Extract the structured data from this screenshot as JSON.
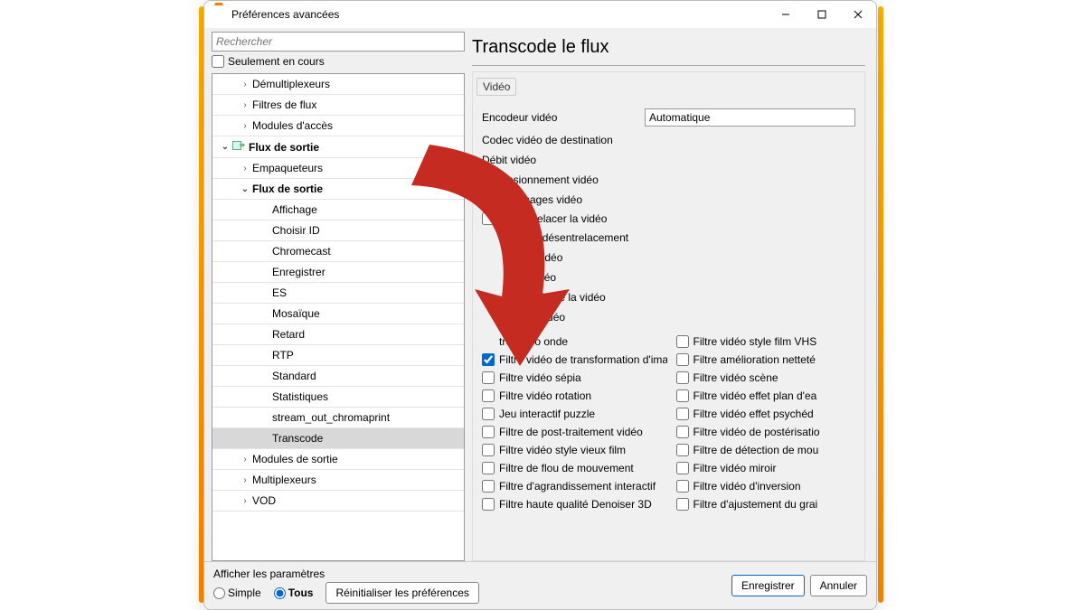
{
  "window": {
    "title": "Préférences avancées"
  },
  "search": {
    "placeholder": "Rechercher",
    "only_current_label": "Seulement en cours"
  },
  "tree": [
    {
      "label": "Démultiplexeurs",
      "indent": 1,
      "expander": "›",
      "bold": false
    },
    {
      "label": "Filtres de flux",
      "indent": 1,
      "expander": "›",
      "bold": false
    },
    {
      "label": "Modules d'accès",
      "indent": 1,
      "expander": "›",
      "bold": false
    },
    {
      "label": "Flux de sortie",
      "indent": 0,
      "expander": "⌄",
      "bold": true,
      "icon": "output"
    },
    {
      "label": "Empaqueteurs",
      "indent": 1,
      "expander": "›",
      "bold": false
    },
    {
      "label": "Flux de sortie",
      "indent": 1,
      "expander": "⌄",
      "bold": true
    },
    {
      "label": "Affichage",
      "indent": 2,
      "expander": "",
      "bold": false
    },
    {
      "label": "Choisir ID",
      "indent": 2,
      "expander": "",
      "bold": false
    },
    {
      "label": "Chromecast",
      "indent": 2,
      "expander": "",
      "bold": false
    },
    {
      "label": "Enregistrer",
      "indent": 2,
      "expander": "",
      "bold": false
    },
    {
      "label": "ES",
      "indent": 2,
      "expander": "",
      "bold": false
    },
    {
      "label": "Mosaïque",
      "indent": 2,
      "expander": "",
      "bold": false
    },
    {
      "label": "Retard",
      "indent": 2,
      "expander": "",
      "bold": false
    },
    {
      "label": "RTP",
      "indent": 2,
      "expander": "",
      "bold": false
    },
    {
      "label": "Standard",
      "indent": 2,
      "expander": "",
      "bold": false
    },
    {
      "label": "Statistiques",
      "indent": 2,
      "expander": "",
      "bold": false
    },
    {
      "label": "stream_out_chromaprint",
      "indent": 2,
      "expander": "",
      "bold": false
    },
    {
      "label": "Transcode",
      "indent": 2,
      "expander": "",
      "bold": false,
      "selected": true
    },
    {
      "label": "Modules de sortie",
      "indent": 1,
      "expander": "›",
      "bold": false
    },
    {
      "label": "Multiplexeurs",
      "indent": 1,
      "expander": "›",
      "bold": false
    },
    {
      "label": "VOD",
      "indent": 1,
      "expander": "›",
      "bold": false
    }
  ],
  "panel": {
    "title": "Transcode le flux",
    "group_label": "Vidéo",
    "rows": [
      {
        "label": "Encodeur vidéo",
        "value": "Automatique",
        "type": "select"
      },
      {
        "label": "Codec vidéo de destination",
        "type": "label"
      },
      {
        "label": "Débit vidéo",
        "type": "label"
      },
      {
        "label": "Dimensionnement vidéo",
        "type": "label"
      },
      {
        "label": "Débit d'images vidéo",
        "type": "label"
      }
    ],
    "single_checks": [
      "Désentrelacer la vidéo"
    ],
    "obscured_rows": [
      "dule de désentrelacement",
      "r de la vidéo",
      "de la vidéo",
      "maximale de la vidéo",
      "e de la vidéo"
    ],
    "filters_left": [
      {
        "label": "tre vidéo onde",
        "checked": false,
        "partially_hidden": true
      },
      {
        "label": "Filtre vidéo de transformation d'image",
        "checked": true
      },
      {
        "label": "Filtre vidéo sépia",
        "checked": false
      },
      {
        "label": "Filtre vidéo rotation",
        "checked": false
      },
      {
        "label": "Jeu interactif puzzle",
        "checked": false
      },
      {
        "label": "Filtre de post-traitement vidéo",
        "checked": false
      },
      {
        "label": "Filtre vidéo style vieux film",
        "checked": false
      },
      {
        "label": "Filtre de flou de mouvement",
        "checked": false
      },
      {
        "label": "Filtre d'agrandissement interactif",
        "checked": false
      },
      {
        "label": "Filtre haute qualité Denoiser 3D",
        "checked": false
      }
    ],
    "filters_right": [
      {
        "label": "Filtre vidéo style film VHS",
        "checked": false
      },
      {
        "label": "Filtre amélioration netteté",
        "checked": false
      },
      {
        "label": "Filtre vidéo scène",
        "checked": false
      },
      {
        "label": "Filtre vidéo effet plan d'ea",
        "checked": false
      },
      {
        "label": "Filtre vidéo effet psychéd",
        "checked": false
      },
      {
        "label": "Filtre vidéo de postérisatio",
        "checked": false
      },
      {
        "label": "Filtre de détection de mou",
        "checked": false
      },
      {
        "label": "Filtre vidéo miroir",
        "checked": false
      },
      {
        "label": "Filtre vidéo d'inversion",
        "checked": false
      },
      {
        "label": "Filtre d'ajustement du grai",
        "checked": false
      }
    ]
  },
  "footer": {
    "show_settings_label": "Afficher les paramètres",
    "radio_simple": "Simple",
    "radio_all": "Tous",
    "reset_label": "Réinitialiser les préférences",
    "save_label": "Enregistrer",
    "cancel_label": "Annuler"
  }
}
